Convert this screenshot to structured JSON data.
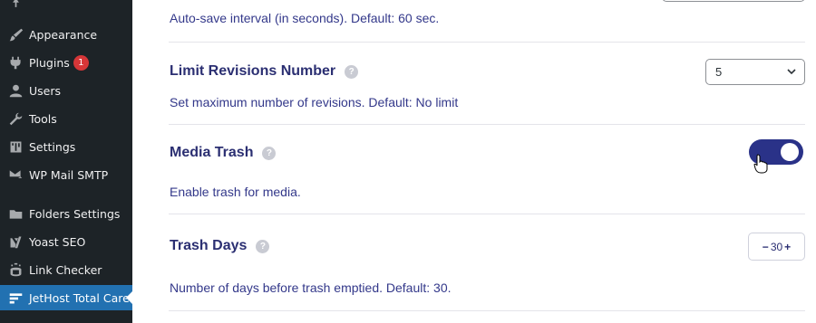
{
  "sidebar": {
    "items": [
      {
        "label": "Appearance",
        "icon": "paintbrush-icon"
      },
      {
        "label": "Plugins",
        "icon": "plugin-icon",
        "badge": "1"
      },
      {
        "label": "Users",
        "icon": "user-icon"
      },
      {
        "label": "Tools",
        "icon": "wrench-icon"
      },
      {
        "label": "Settings",
        "icon": "settings-icon"
      },
      {
        "label": "WP Mail SMTP",
        "icon": "mail-icon"
      },
      {
        "label": "Folders Settings",
        "icon": "folder-icon"
      },
      {
        "label": "Yoast SEO",
        "icon": "yoast-icon"
      },
      {
        "label": "Link Checker",
        "icon": "link-checker-icon"
      },
      {
        "label": "JetHost Total Care",
        "icon": "jethost-icon",
        "active": true
      }
    ]
  },
  "settings": {
    "autosave": {
      "desc": "Auto-save interval (in seconds). Default: 60 sec."
    },
    "revisions": {
      "title": "Limit Revisions Number",
      "desc": "Set maximum number of revisions. Default: No limit",
      "value": "5"
    },
    "media_trash": {
      "title": "Media Trash",
      "desc": "Enable trash for media.",
      "enabled": true
    },
    "trash_days": {
      "title": "Trash Days",
      "desc": "Number of days before trash emptied. Default: 30.",
      "value": "30",
      "minus": "−",
      "plus": "+"
    }
  },
  "help_glyph": "?",
  "colors": {
    "sidebar_bg": "#1d2327",
    "active_bg": "#2271b1",
    "accent": "#2a3288",
    "badge": "#d63638"
  }
}
